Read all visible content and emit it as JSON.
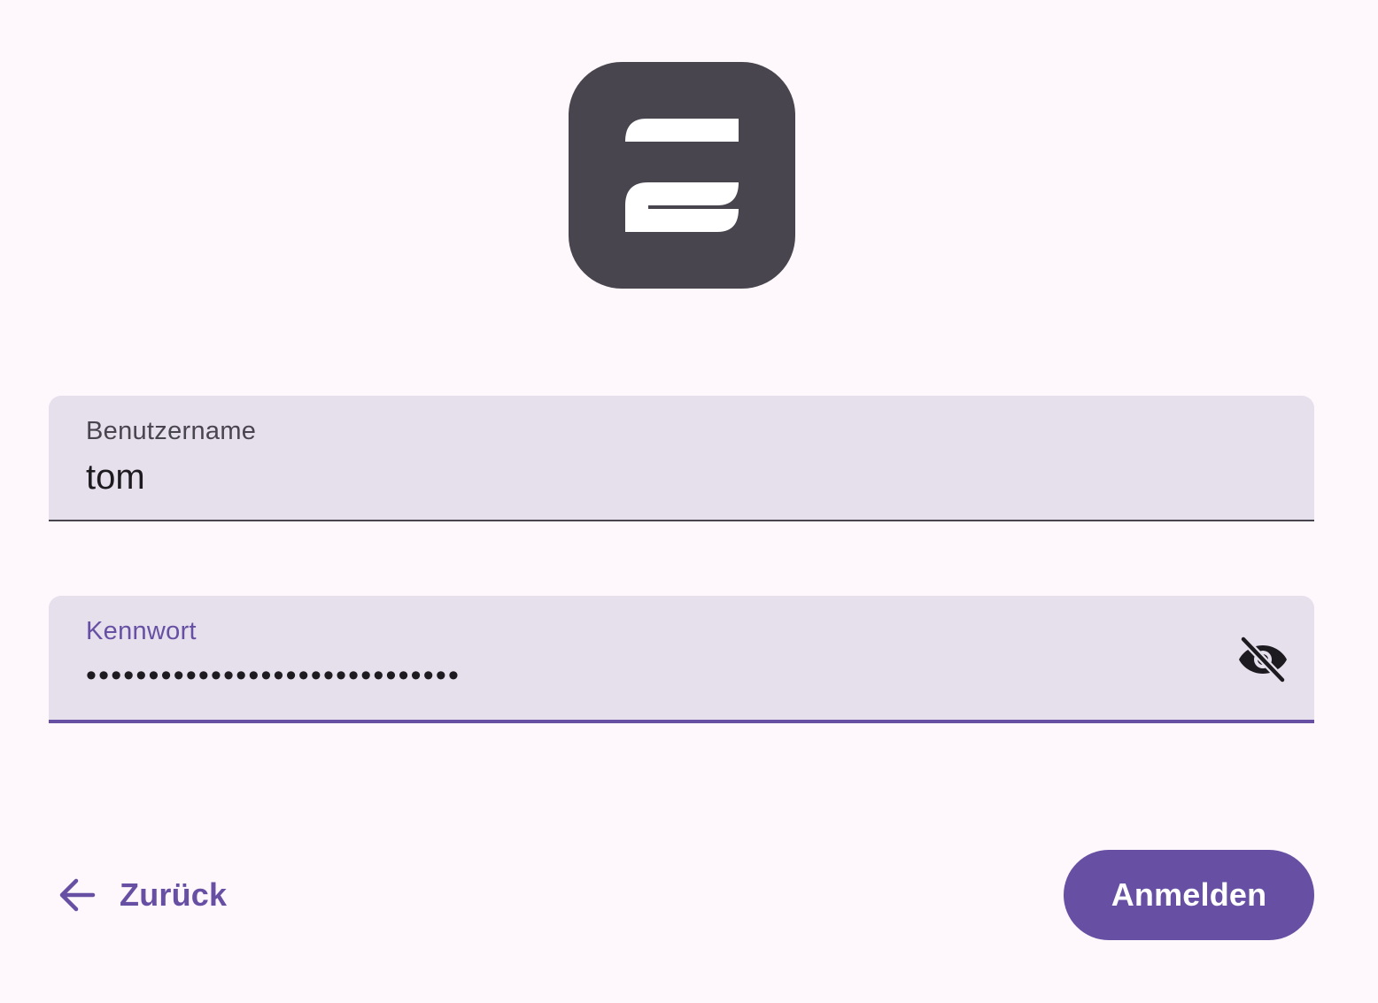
{
  "logo": {
    "icon": "app-logo-icon",
    "background_color": "#48454e",
    "glyph_color": "#ffffff"
  },
  "username_field": {
    "label": "Benutzername",
    "value": "tom"
  },
  "password_field": {
    "label": "Kennwort",
    "masked_value": "••••••••••••••••••••••••••••••",
    "visibility_toggle_icon": "eye-off-icon"
  },
  "actions": {
    "back_label": "Zurück",
    "back_icon": "arrow-left-icon",
    "login_label": "Anmelden"
  },
  "colors": {
    "accent": "#6750a4",
    "background": "#fef7fc",
    "field_fill": "#e6e0ec"
  }
}
